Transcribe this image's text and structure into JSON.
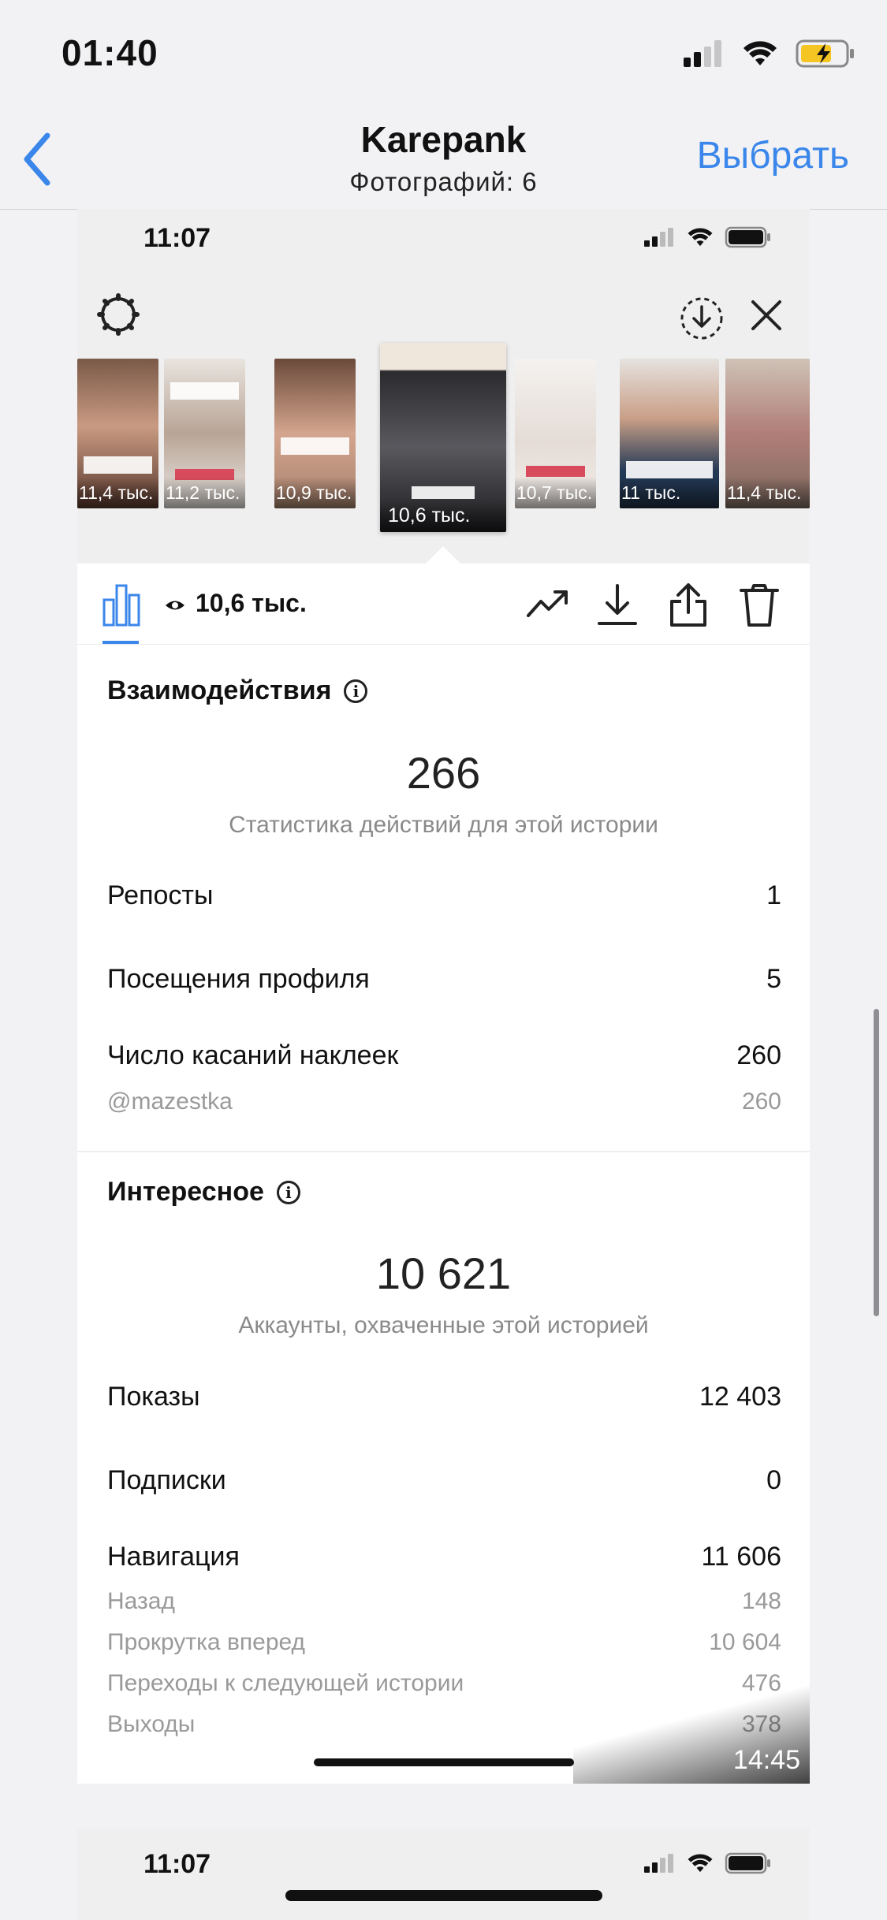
{
  "status_bar": {
    "time": "01:40"
  },
  "nav": {
    "title": "Karepank",
    "subtitle": "Фотографий: 6",
    "select_label": "Выбрать"
  },
  "story_screen": {
    "status_time": "11:07",
    "thumbnails": [
      {
        "views": "11,4 тыс."
      },
      {
        "views": "11,2 тыс."
      },
      {
        "views": "10,9 тыс."
      },
      {
        "views": "10,6 тыс.",
        "selected": true
      },
      {
        "views": "10,7 тыс."
      },
      {
        "views": "11 тыс."
      },
      {
        "views": "11,4 тыс."
      }
    ],
    "toolbar": {
      "views": "10,6 тыс."
    },
    "interactions": {
      "title": "Взаимодействия",
      "total": "266",
      "caption": "Статистика действий для этой истории",
      "rows": [
        {
          "label": "Репосты",
          "value": "1"
        },
        {
          "label": "Посещения профиля",
          "value": "5"
        },
        {
          "label": "Число касаний наклеек",
          "value": "260"
        }
      ],
      "sticker": {
        "label": "@mazestka",
        "value": "260"
      }
    },
    "discovery": {
      "title": "Интересное",
      "total": "10 621",
      "caption": "Аккаунты, охваченные этой историей",
      "rows": [
        {
          "label": "Показы",
          "value": "12 403"
        },
        {
          "label": "Подписки",
          "value": "0"
        },
        {
          "label": "Навигация",
          "value": "11 606"
        }
      ],
      "nav_rows": [
        {
          "label": "Назад",
          "value": "148"
        },
        {
          "label": "Прокрутка вперед",
          "value": "10 604"
        },
        {
          "label": "Переходы к следующей истории",
          "value": "476"
        },
        {
          "label": "Выходы",
          "value": "378"
        }
      ]
    },
    "video_time": "14:45"
  },
  "next_story_screen": {
    "status_time": "11:07"
  },
  "colors": {
    "accent": "#3a86ea",
    "background": "#f2f2f4"
  }
}
